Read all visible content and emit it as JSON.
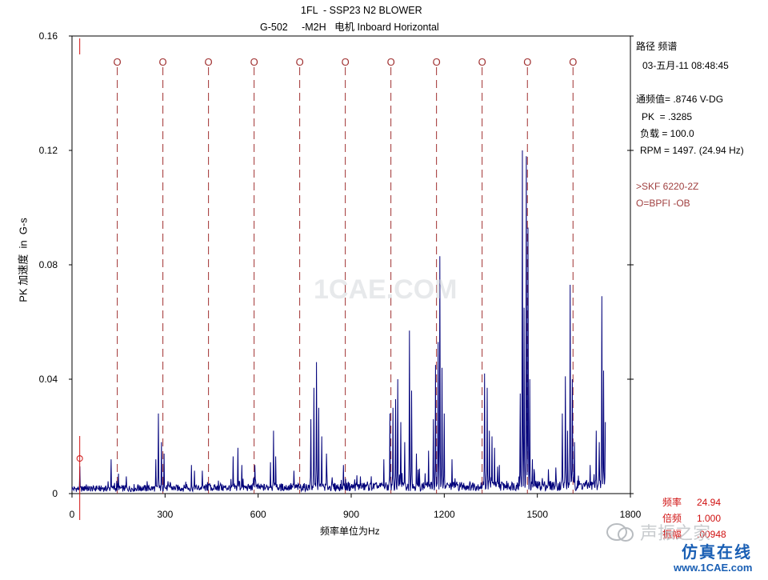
{
  "header": {
    "title_line1": "1FL  - SSP23 N2 BLOWER",
    "title_line2": "G-502     -M2H   电机 Inboard Horizontal"
  },
  "info_panel": {
    "route": "路径 频谱",
    "datetime": "03-五月-11 08:48:45",
    "overall": "通频值= .8746 V-DG",
    "pk": "PK  = .3285",
    "load": "负载 = 100.0",
    "rpm": "RPM = 1497. (24.94 Hz)",
    "bearing": ">SKF 6220-2Z",
    "fault_legend": "O=BPFI -OB"
  },
  "readout": {
    "freq_label": "频率",
    "freq_value": "24.94",
    "order_label": "倍频",
    "order_value": "1.000",
    "amp_label": "振幅",
    "amp_value": ".00948"
  },
  "watermarks": {
    "center": "1CAE.COM",
    "brand1": "声振之家",
    "brand2": "仿真在线",
    "site": "www.1CAE.com"
  },
  "colors": {
    "spectrum": "#00007a",
    "fault_lines": "#a03030",
    "cursor": "#d01010",
    "axes": "#000000"
  },
  "chart_data": {
    "type": "line",
    "xlabel": "频率单位为Hz",
    "ylabel": "PK 加速度  in  G-s",
    "xlim": [
      0,
      1800
    ],
    "ylim": [
      0,
      0.16
    ],
    "x_ticks": [
      0,
      300,
      600,
      900,
      1200,
      1500,
      1800
    ],
    "y_ticks": [
      0,
      0.04,
      0.08,
      0.12,
      0.16
    ],
    "y_tick_labels": [
      "0",
      "0.04",
      "0.08",
      "0.12",
      "0.16"
    ],
    "cursor_x": 24.94,
    "cursor_amplitude": 0.00948,
    "fault_frequency_label": "O",
    "fault_frequencies": [
      146,
      293,
      440,
      587,
      734,
      881,
      1028,
      1175,
      1322,
      1468,
      1615
    ],
    "spectrum_peaks": [
      [
        24.9,
        0.0095
      ],
      [
        126,
        0.012
      ],
      [
        150,
        0.007
      ],
      [
        175,
        0.006
      ],
      [
        270,
        0.012
      ],
      [
        279,
        0.028
      ],
      [
        288,
        0.018
      ],
      [
        297,
        0.014
      ],
      [
        385,
        0.01
      ],
      [
        395,
        0.008
      ],
      [
        420,
        0.008
      ],
      [
        520,
        0.013
      ],
      [
        535,
        0.016
      ],
      [
        548,
        0.01
      ],
      [
        590,
        0.01
      ],
      [
        640,
        0.011
      ],
      [
        649,
        0.022
      ],
      [
        657,
        0.013
      ],
      [
        715,
        0.008
      ],
      [
        770,
        0.026
      ],
      [
        780,
        0.037
      ],
      [
        788,
        0.046
      ],
      [
        795,
        0.03
      ],
      [
        805,
        0.02
      ],
      [
        820,
        0.014
      ],
      [
        875,
        0.01
      ],
      [
        930,
        0.006
      ],
      [
        1005,
        0.012
      ],
      [
        1025,
        0.028
      ],
      [
        1035,
        0.03
      ],
      [
        1043,
        0.033
      ],
      [
        1050,
        0.04
      ],
      [
        1060,
        0.025
      ],
      [
        1072,
        0.018
      ],
      [
        1088,
        0.057
      ],
      [
        1095,
        0.036
      ],
      [
        1110,
        0.014
      ],
      [
        1150,
        0.015
      ],
      [
        1165,
        0.026
      ],
      [
        1172,
        0.045
      ],
      [
        1180,
        0.053
      ],
      [
        1186,
        0.083
      ],
      [
        1193,
        0.044
      ],
      [
        1200,
        0.028
      ],
      [
        1225,
        0.012
      ],
      [
        1330,
        0.042
      ],
      [
        1338,
        0.037
      ],
      [
        1346,
        0.022
      ],
      [
        1354,
        0.02
      ],
      [
        1362,
        0.016
      ],
      [
        1378,
        0.01
      ],
      [
        1445,
        0.035
      ],
      [
        1452,
        0.12
      ],
      [
        1458,
        0.065
      ],
      [
        1464,
        0.118
      ],
      [
        1470,
        0.093
      ],
      [
        1476,
        0.04
      ],
      [
        1484,
        0.012
      ],
      [
        1580,
        0.028
      ],
      [
        1590,
        0.041
      ],
      [
        1598,
        0.022
      ],
      [
        1606,
        0.073
      ],
      [
        1613,
        0.04
      ],
      [
        1620,
        0.018
      ],
      [
        1670,
        0.01
      ],
      [
        1690,
        0.022
      ],
      [
        1700,
        0.018
      ],
      [
        1708,
        0.069
      ],
      [
        1714,
        0.043
      ],
      [
        1720,
        0.025
      ]
    ]
  }
}
